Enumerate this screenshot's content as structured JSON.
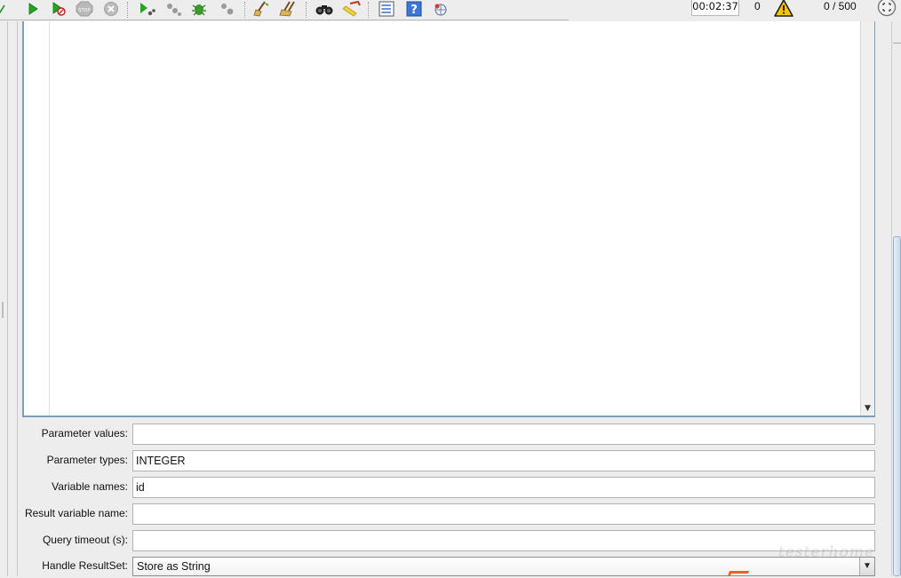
{
  "toolbar": {
    "timer": "00:02:37",
    "error_count": "0",
    "thread_count": "0 / 500",
    "icons": [
      "check-mark-icon",
      "start-icon",
      "start-no-pause-icon",
      "stop-icon",
      "shutdown-icon",
      "remote-start-icon",
      "remote-stop-icon",
      "remote-shutdown-icon",
      "remote-exit-icon",
      "clear-icon",
      "clear-all-icon",
      "search-icon",
      "reset-search-icon",
      "function-helper-icon",
      "help-icon",
      "remote-icon",
      "warning-icon",
      "expand-icon"
    ]
  },
  "form": {
    "parameter_values": {
      "label": "Parameter values:",
      "value": ""
    },
    "parameter_types": {
      "label": "Parameter types:",
      "value": "INTEGER"
    },
    "variable_names": {
      "label": "Variable names:",
      "value": "id"
    },
    "result_variable_name": {
      "label": "Result variable name:",
      "value": ""
    },
    "query_timeout": {
      "label": "Query timeout (s):",
      "value": ""
    },
    "handle_resultset": {
      "label": "Handle ResultSet:",
      "selected": "Store as String"
    }
  },
  "colors": {
    "accent_border": "#7f9db9",
    "warning": "#f2c500",
    "start_green": "#1aa51a"
  },
  "watermark": "testerhome"
}
